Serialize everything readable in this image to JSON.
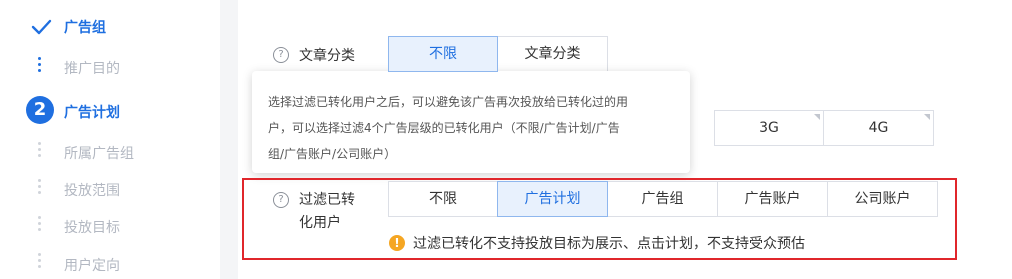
{
  "steps": {
    "ad_group": "广告组",
    "promote_purpose": "推广目的",
    "ad_plan_number": "2",
    "ad_plan": "广告计划",
    "belong_ad_group": "所属广告组",
    "placement_range": "投放范围",
    "placement_target": "投放目标",
    "user_targeting": "用户定向"
  },
  "article_category": {
    "label": "文章分类",
    "options": [
      "不限",
      "文章分类"
    ],
    "selected": "不限"
  },
  "network": {
    "options": [
      "3G",
      "4G"
    ]
  },
  "tooltip": {
    "line1": "选择过滤已转化用户之后，可以避免该广告再次投放给已转化过的用",
    "line2": "户，可以选择过滤4个广告层级的已转化用户（不限/广告计划/广告",
    "line3": "组/广告账户/公司账户）"
  },
  "filter_converted": {
    "label_line1": "过滤已转",
    "label_line2": "化用户",
    "options": [
      "不限",
      "广告计划",
      "广告组",
      "广告账户",
      "公司账户"
    ],
    "selected": "广告计划",
    "warning": "过滤已转化不支持投放目标为展示、点击计划，不支持受众预估"
  },
  "colors": {
    "primary": "#1f6fe0",
    "highlight_border": "#e0262b",
    "warning": "#f5a623"
  }
}
